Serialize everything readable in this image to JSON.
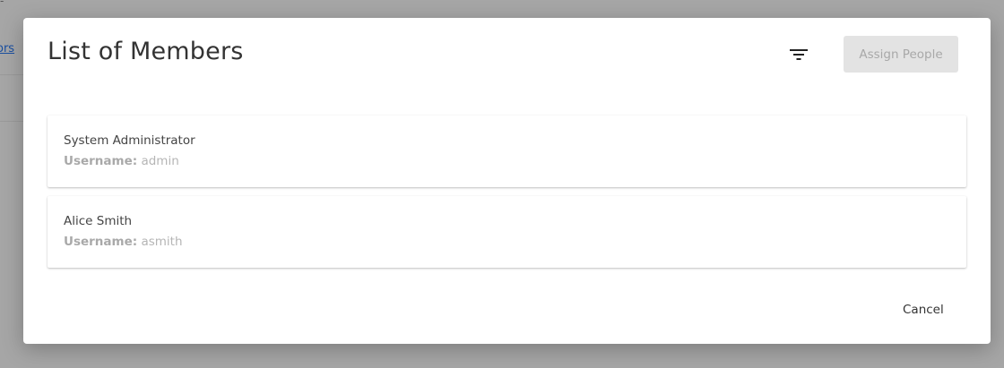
{
  "background": {
    "link_fragment": "ors",
    "dash": "-"
  },
  "dialog": {
    "title": "List of Members",
    "filter_icon": "filter-icon",
    "assign_button_label": "Assign People",
    "members": [
      {
        "name": "System Administrator",
        "username_label": "Username:",
        "username": "admin"
      },
      {
        "name": "Alice Smith",
        "username_label": "Username:",
        "username": "asmith"
      }
    ],
    "cancel_label": "Cancel"
  },
  "colors": {
    "backdrop": "#a6a6a6",
    "dialog_bg": "#ffffff",
    "disabled_button_bg": "#e3e3e3",
    "disabled_button_text": "#a8a8a8",
    "link": "#1a4fa0"
  }
}
